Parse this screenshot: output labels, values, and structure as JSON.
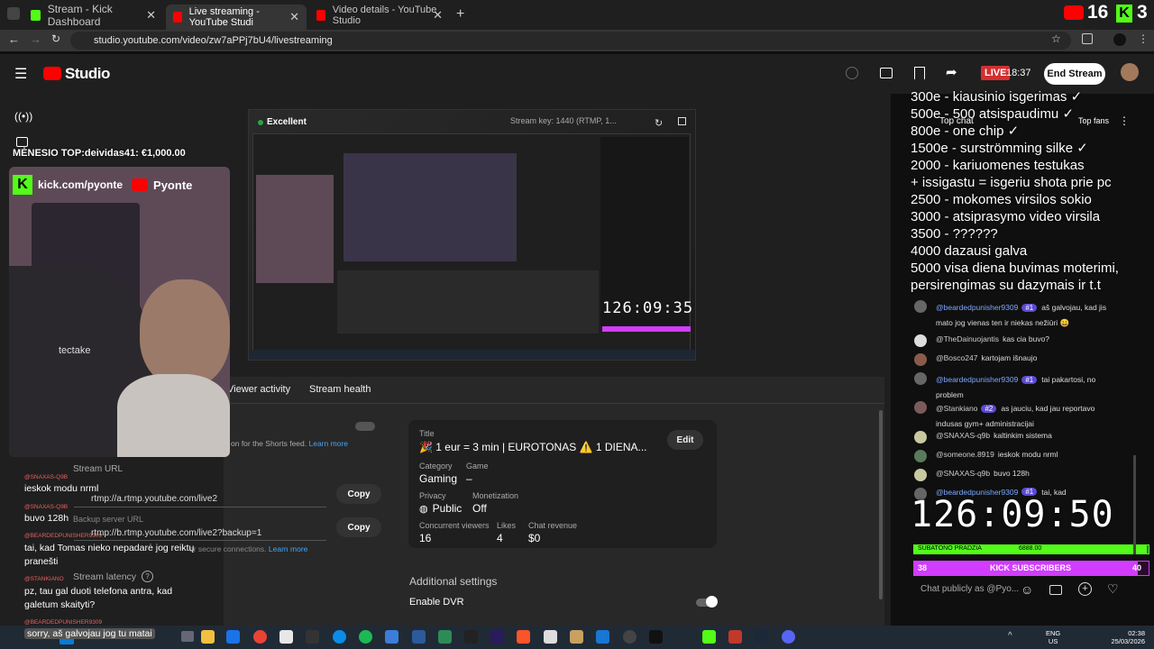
{
  "tabs": [
    {
      "title": "Stream - Kick Dashboard",
      "icon": "kick-icon"
    },
    {
      "title": "Live streaming - YouTube Studi",
      "icon": "youtube-icon"
    },
    {
      "title": "Video details - YouTube Studio",
      "icon": "youtube-icon"
    }
  ],
  "url": "studio.youtube.com/video/zw7aPPj7bU4/livestreaming",
  "header": {
    "brand": "Studio",
    "live_label": "LIVE",
    "live_time": "18:37",
    "end_stream": "End Stream"
  },
  "overlay_counter": {
    "left_num": "16",
    "right_num": "3"
  },
  "preview": {
    "quality": "Excellent",
    "stream_key": "Stream key: 1440 (RTMP, 1...",
    "timer": "126:09:35"
  },
  "panel": {
    "tabs": [
      "Viewer activity",
      "Stream health"
    ],
    "shorts_text": "on for the Shorts feed.",
    "learn_more": "Learn more",
    "stream_url_label": "Stream URL",
    "stream_url": "rtmp://a.rtmp.youtube.com/live2",
    "backup_url_label": "Backup server URL",
    "backup_url": "rtmp://b.rtmp.youtube.com/live2?backup=1",
    "secure_text": "or secure connections.",
    "learn_more2": "Learn more",
    "copy": "Copy",
    "latency_label": "Stream latency",
    "title_label": "Title",
    "title": "🎉 1 eur = 3 min | EUROTONAS ⚠️ 1 DIENA...",
    "edit": "Edit",
    "category_label": "Category",
    "category": "Gaming",
    "game_label": "Game",
    "game": "–",
    "privacy_label": "Privacy",
    "privacy": "Public",
    "monetization_label": "Monetization",
    "monetization": "Off",
    "viewers_label": "Concurrent viewers",
    "viewers": "16",
    "likes_label": "Likes",
    "likes": "4",
    "revenue_label": "Chat revenue",
    "revenue": "$0",
    "additional": "Additional settings",
    "dvr": "Enable DVR"
  },
  "webcam": {
    "top_text": "MĖNESIO TOP:deividas41: €1,000.00",
    "kick_url": "kick.com/pyonte",
    "yt_name": "Pyonte",
    "brand": "tectake"
  },
  "left_chat": [
    {
      "name": "@SNAXAS-Q9B",
      "msg": "ieskok modu nrml"
    },
    {
      "name": "@SNAXAS-Q9B",
      "msg": "buvo 128h"
    },
    {
      "name": "@BEARDEDPUNISHER9309",
      "msg": "tai, kad Tomas nieko nepadarė jog reiktų pranešti"
    },
    {
      "name": "@STANKIANO",
      "msg": "pz, tau gal duoti telefona antra, kad galetum skaityti?"
    },
    {
      "name": "@BEARDEDPUNISHER9309",
      "msg": "sorry, aš galvojau jog tu matai"
    }
  ],
  "chat": {
    "top_label": "Top chat",
    "top_fans": "Top fans",
    "input_placeholder": "Chat publicly as @Pyo...",
    "menu": [
      "300e - kiausinio isgerimas ✓",
      "500e - 500 atsispaudimu ✓",
      "800e - one chip ✓",
      "1500e - surströmming silke ✓",
      "2000 - kariuomenes testukas",
      "+ issigastu = isgeriu shota prie pc",
      "2500 - mokomes virsilos sokio",
      "3000 - atsiprasymo video virsila",
      "3500 - ??????",
      "4000 dazausi galva",
      "5000 visa diena buvimas moterimi,",
      "persirengimas su dazymais ir t.t"
    ],
    "messages": [
      {
        "name": "@beardedpunisher9309",
        "badge": "#1",
        "msg": "aš galvojau, kad jis mato jog vienas ten ir niekas nežiūri 😀",
        "blue": true
      },
      {
        "name": "@TheDainuojantis",
        "badge": "",
        "msg": "kas cia buvo?",
        "blue": false
      },
      {
        "name": "@Bosco247",
        "badge": "",
        "msg": "kartojam išnaujo",
        "blue": false
      },
      {
        "name": "@beardedpunisher9309",
        "badge": "#1",
        "msg": "tai pakartosi, no problem",
        "blue": true
      },
      {
        "name": "@Stankiano",
        "badge": "#2",
        "msg": "as jauciu, kad jau reportavo indusas gym+ administracijai",
        "blue": false
      },
      {
        "name": "@SNAXAS-q9b",
        "badge": "",
        "msg": "kaltinkim sistema",
        "blue": false
      },
      {
        "name": "@someone.8919",
        "badge": "",
        "msg": "ieskok modu nrml",
        "blue": false
      },
      {
        "name": "@SNAXAS-q9b",
        "badge": "",
        "msg": "buvo 128h",
        "blue": false
      },
      {
        "name": "@beardedpunisher9309",
        "badge": "#1",
        "msg": "tai, kad",
        "blue": true
      }
    ],
    "big_timer": "126:09:50",
    "goal_label": "SUBATONO PRADZIA",
    "goal_value": "6888.00",
    "kick_subs_num": "38",
    "kick_subs_label": "KICK SUBSCRIBERS",
    "kick_subs_goal": "40"
  },
  "taskbar": {
    "lang": "ENG",
    "region": "US",
    "time": "02:38",
    "date": "25/03/2026"
  }
}
